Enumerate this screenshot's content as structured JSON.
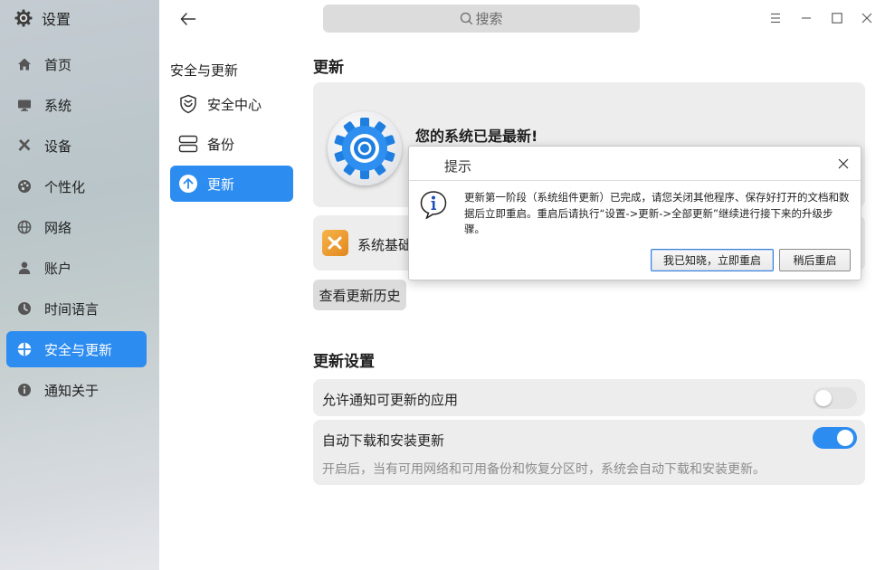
{
  "app": {
    "title": "设置"
  },
  "sidebar": {
    "items": [
      {
        "label": "首页",
        "icon": "home-icon"
      },
      {
        "label": "系统",
        "icon": "monitor-icon"
      },
      {
        "label": "设备",
        "icon": "tools-icon"
      },
      {
        "label": "个性化",
        "icon": "palette-icon"
      },
      {
        "label": "网络",
        "icon": "globe-icon"
      },
      {
        "label": "账户",
        "icon": "user-icon"
      },
      {
        "label": "时间语言",
        "icon": "clock-icon"
      },
      {
        "label": "安全与更新",
        "icon": "security-icon",
        "active": true
      },
      {
        "label": "通知关于",
        "icon": "info-icon"
      }
    ]
  },
  "search": {
    "placeholder": "搜索"
  },
  "middle": {
    "title": "安全与更新",
    "items": [
      {
        "label": "安全中心",
        "icon": "shield-icon"
      },
      {
        "label": "备份",
        "icon": "backup-icon"
      },
      {
        "label": "更新",
        "icon": "upload-arrow-icon",
        "active": true
      }
    ]
  },
  "update": {
    "heading": "更新",
    "status": "您的系统已是最新!",
    "package_name": "系统基础",
    "history_button": "查看更新历史"
  },
  "settings": {
    "heading": "更新设置",
    "allow_notify": {
      "label": "允许通知可更新的应用",
      "enabled": false
    },
    "auto_download": {
      "label": "自动下载和安装更新",
      "description": "开启后，当有可用网络和可用备份和恢复分区时，系统会自动下载和安装更新。",
      "enabled": true
    }
  },
  "dialog": {
    "title": "提示",
    "message": "更新第一阶段（系统组件更新）已完成，请您关闭其他程序、保存好打开的文档和数据后立即重启。重启后请执行“设置->更新->全部更新”继续进行接下来的升级步骤。",
    "confirm_button": "我已知晓，立即重启",
    "later_button": "稍后重启"
  },
  "colors": {
    "accent": "#2d8cf0"
  }
}
